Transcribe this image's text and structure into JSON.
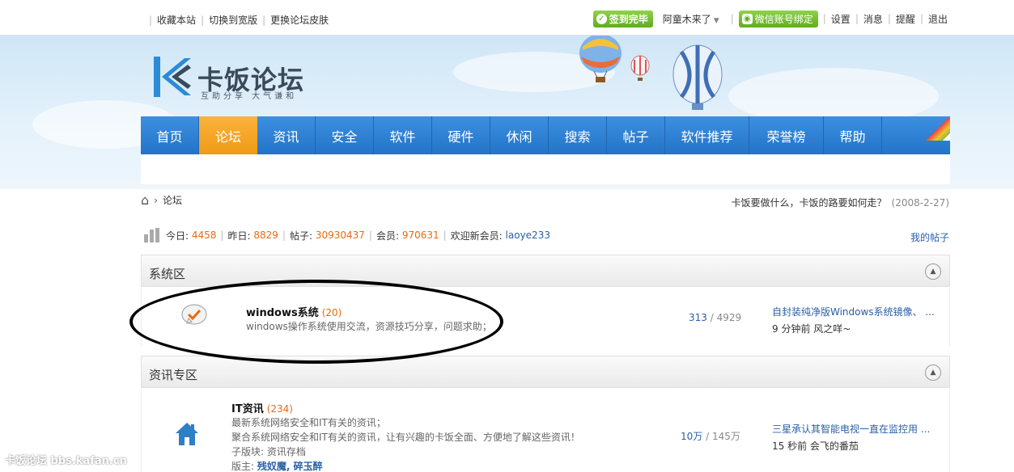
{
  "topbar": {
    "left_links": [
      "收藏本站",
      "切换到宽版",
      "更换论坛皮肤"
    ],
    "signin_badge": "签到完毕",
    "username": "阿童木来了",
    "wechat_badge": "微信账号绑定",
    "right_links": [
      "设置",
      "消息",
      "提醒",
      "退出"
    ]
  },
  "logo": {
    "name": "卡饭论坛",
    "slogan": "互助分享  大气谦和"
  },
  "nav": {
    "items": [
      "首页",
      "论坛",
      "资讯",
      "安全",
      "软件",
      "硬件",
      "休闲",
      "搜索",
      "帖子",
      "软件推荐",
      "荣誉榜",
      "帮助"
    ],
    "active": "论坛"
  },
  "breadcrumb": {
    "current": "论坛"
  },
  "notice": {
    "text": "卡饭要做什么，卡饭的路要如何走？",
    "date": "(2008-2-27)"
  },
  "stats": {
    "today_label": "今日:",
    "today": "4458",
    "yesterday_label": "昨日:",
    "yesterday": "8829",
    "posts_label": "帖子:",
    "posts": "30930437",
    "members_label": "会员:",
    "members": "970631",
    "welcome_label": "欢迎新会员:",
    "newest_member": "laoye233",
    "my_posts": "我的帖子"
  },
  "sections": [
    {
      "title": "系统区",
      "forums": [
        {
          "name": "windows系统",
          "count": "(20)",
          "desc": "windows操作系统使用交流，资源技巧分享，问题求助；",
          "threads": "313",
          "posts": "/ 4929",
          "last_title": "自封装纯净版Windows系统镜像、 ...",
          "last_meta": "9 分钟前 风之咩~"
        }
      ]
    },
    {
      "title": "资讯专区",
      "forums": [
        {
          "name": "IT资讯",
          "count": "(234)",
          "desc1": "最新系统网络安全和IT有关的资讯；",
          "desc2": "聚合系统网络安全和IT有关的资讯，让有兴趣的卡饭全面、方便地了解这些资讯！",
          "sub_label": "子版块:",
          "sub": "资讯存档",
          "mod_label": "版主:",
          "mods": "残奴魔, 碎玉醉",
          "threads": "10万",
          "posts": "/ 145万",
          "last_title": "三星承认其智能电视一直在监控用 ...",
          "last_meta": "15 秒前 会飞的番茄"
        }
      ]
    }
  ],
  "watermark": "卡饭论坛 bbs.kafan.cn",
  "colors": {
    "nav_blue": "#2a7ad6",
    "nav_active": "#f5a623",
    "link_blue": "#2a5fa8",
    "count_orange": "#e86a10"
  }
}
